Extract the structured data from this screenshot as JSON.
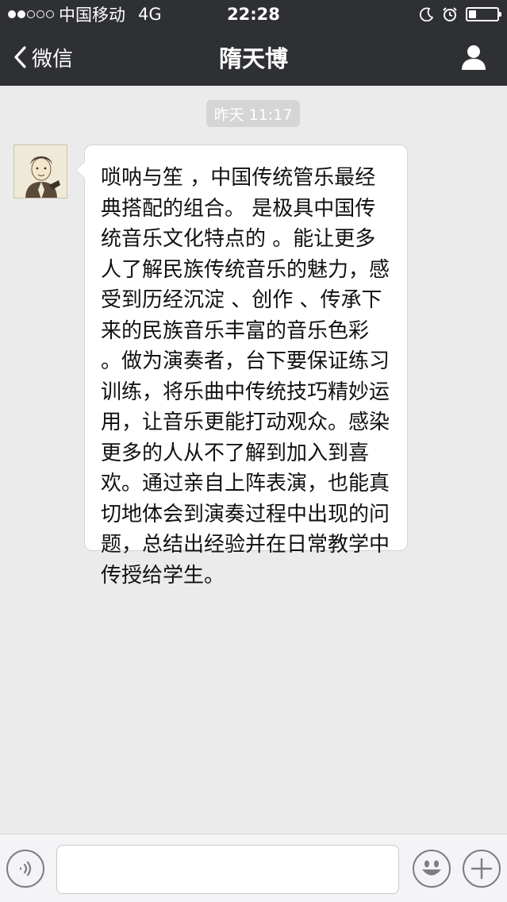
{
  "status_bar": {
    "carrier": "中国移动",
    "network": "4G",
    "time": "22:28",
    "signal_strength": 2,
    "signal_max": 5,
    "battery_level": 0.25
  },
  "nav": {
    "back_label": "微信",
    "title": "隋天博"
  },
  "chat": {
    "timestamp": "昨天 11:17",
    "messages": [
      {
        "sender": "left",
        "text": "唢呐与笙 ，中国传统管乐最经典搭配的组合。 是极具中国传统音乐文化特点的 。能让更多人了解民族传统音乐的魅力，感受到历经沉淀 、创作 、传承下来的民族音乐丰富的音乐色彩 。做为演奏者，台下要保证练习训练，将乐曲中传统技巧精妙运用，让音乐更能打动观众。感染更多的人从不了解到加入到喜欢。通过亲自上阵表演，也能真切地体会到演奏过程中出现的问题，总结出经验并在日常教学中传授给学生。"
      }
    ]
  },
  "input_bar": {
    "value": "",
    "placeholder": ""
  },
  "colors": {
    "header_bg": "#2e3033",
    "chat_bg": "#ebebeb",
    "bubble_bg": "#ffffff",
    "timestamp_bg": "#d5d5d5"
  },
  "icons": {
    "back": "chevron-left-icon",
    "profile": "person-icon",
    "moon": "moon-icon",
    "alarm": "alarm-clock-icon",
    "battery": "battery-icon",
    "voice": "voice-icon",
    "emoji": "emoji-icon",
    "plus": "plus-icon"
  }
}
